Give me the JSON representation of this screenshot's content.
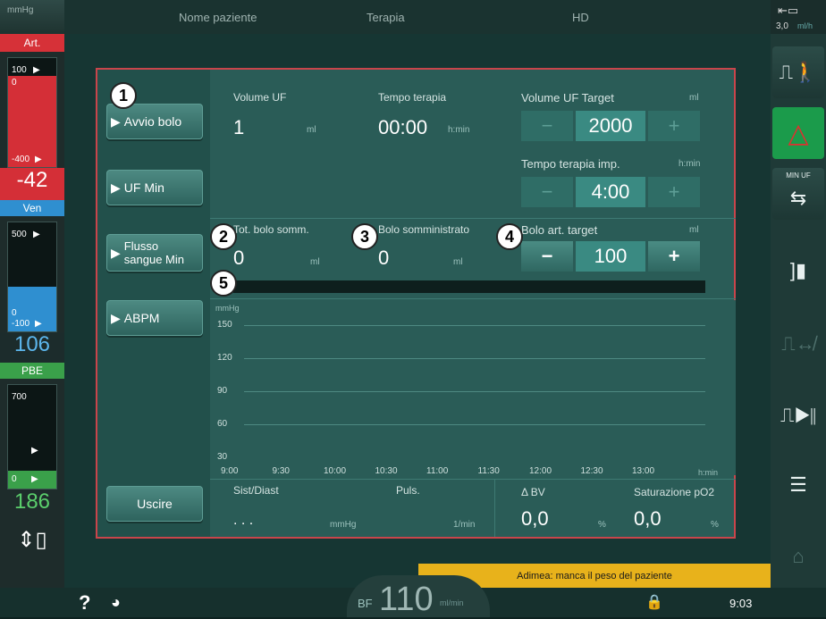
{
  "topbar": {
    "unit": "mmHg",
    "patient_name": "Nome paziente",
    "therapy": "Terapia",
    "mode": "HD",
    "uf_rate": "3,0",
    "uf_rate_unit": "ml/h"
  },
  "left_panel": {
    "art": {
      "label": "Art.",
      "top": "100",
      "top2": "0",
      "bottom": "-400",
      "value": "-42"
    },
    "ven": {
      "label": "Ven",
      "top": "500",
      "bottom1": "0",
      "bottom2": "-100",
      "value": "106"
    },
    "pbe": {
      "label": "PBE",
      "top": "700",
      "bottom": "0",
      "value": "186"
    }
  },
  "dialog": {
    "buttons": {
      "avvio_bolo": "Avvio bolo",
      "uf_min": "UF Min",
      "flusso_line1": "Flusso",
      "flusso_line2": "sangue Min",
      "abpm": "ABPM",
      "uscire": "Uscire"
    },
    "volume_uf": {
      "label": "Volume UF",
      "value": "1",
      "unit": "ml"
    },
    "tempo_terapia": {
      "label": "Tempo terapia",
      "value": "00:00",
      "unit": "h:min"
    },
    "volume_uf_target": {
      "label": "Volume UF Target",
      "unit": "ml",
      "minus": "−",
      "value": "2000",
      "plus": "+"
    },
    "tempo_terapia_imp": {
      "label": "Tempo terapia imp.",
      "unit": "h:min",
      "minus": "−",
      "value": "4:00",
      "plus": "+"
    },
    "tot_bolo": {
      "label": "Tot. bolo somm.",
      "value": "0",
      "unit": "ml"
    },
    "bolo_somm": {
      "label": "Bolo somministrato",
      "value": "0",
      "unit": "ml"
    },
    "bolo_art_target": {
      "label": "Bolo art. target",
      "unit": "ml",
      "minus": "−",
      "value": "100",
      "plus": "+"
    },
    "progress": 0,
    "chart": {
      "unit": "mmHg",
      "y_ticks": [
        "150",
        "120",
        "90",
        "60",
        "30"
      ],
      "x_ticks": [
        "9:00",
        "9:30",
        "10:00",
        "10:30",
        "11:00",
        "11:30",
        "12:00",
        "12:30",
        "13:00"
      ],
      "x_unit": "h:min"
    },
    "sist_diast": {
      "label": "Sist/Diast",
      "value": ". . .",
      "unit": "mmHg"
    },
    "puls": {
      "label": "Puls.",
      "unit": "1/min"
    },
    "delta_bv": {
      "label": "Δ BV",
      "value": "0,0",
      "unit": "%"
    },
    "sat_po2": {
      "label": "Saturazione pO2",
      "value": "0,0",
      "unit": "%"
    },
    "callouts": [
      "1",
      "2",
      "3",
      "4",
      "5"
    ]
  },
  "right_panel": {
    "min_uf_label": "MIN UF"
  },
  "alert": {
    "text": "Adimea: manca il peso del paziente"
  },
  "bottombar": {
    "help": "?",
    "bf_label": "BF",
    "bf_value": "110",
    "bf_unit": "ml/min",
    "time": "9:03"
  },
  "colors": {
    "accent_red": "#c9454b",
    "art_red": "#e0313a",
    "ven_blue": "#2f8fd0",
    "pbe_green": "#3aa04a",
    "alert_yellow": "#e8b21b"
  }
}
